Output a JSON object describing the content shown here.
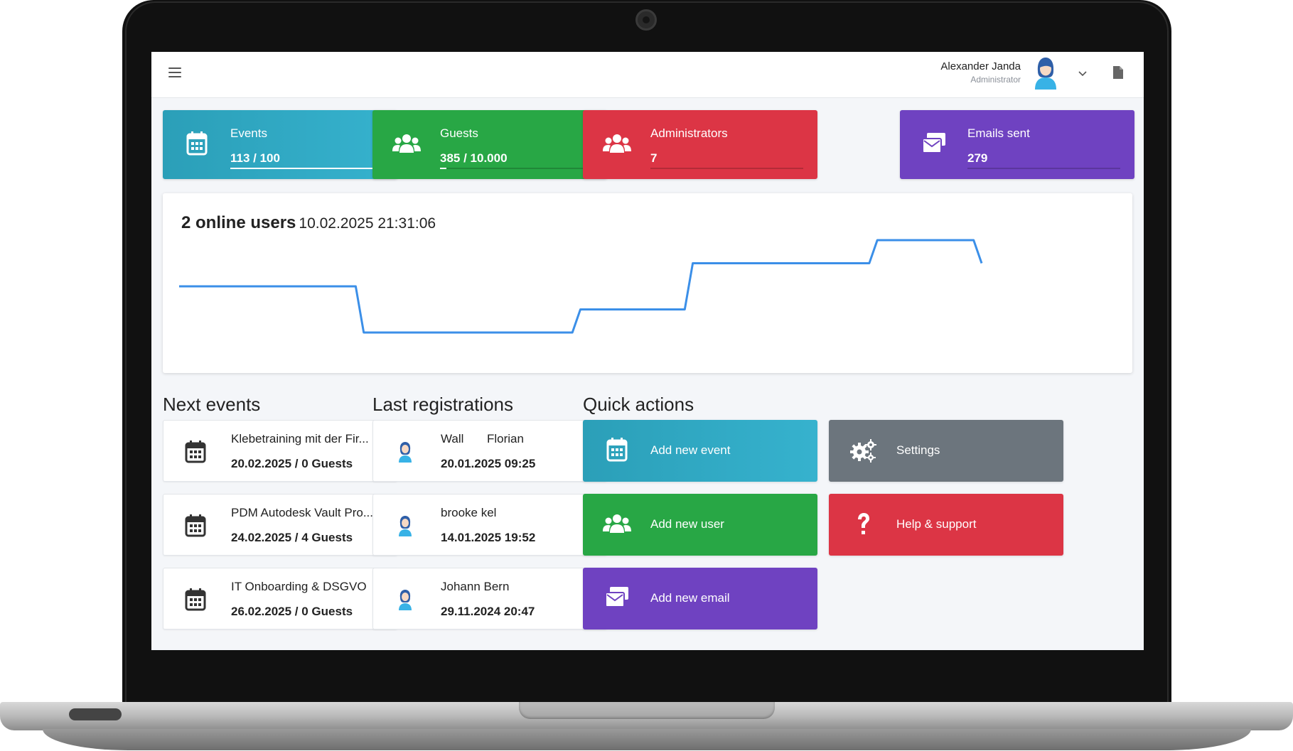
{
  "header": {
    "user_name": "Alexander Janda",
    "user_role": "Administrator"
  },
  "stats": [
    {
      "label": "Events",
      "value": "113 / 100",
      "progress": 1.0,
      "color": "#2fa9c2",
      "icon": "calendar-icon"
    },
    {
      "label": "Guests",
      "value": "385 / 10.000",
      "progress": 0.04,
      "color": "#28a745",
      "icon": "users-icon"
    },
    {
      "label": "Administrators",
      "value": "7",
      "progress": 0,
      "color": "#dc3545",
      "icon": "users-icon"
    },
    {
      "label": "Emails sent",
      "value": "279",
      "progress": 0,
      "color": "#6f42c1",
      "icon": "mail-stack-icon"
    }
  ],
  "online": {
    "title": "2 online users",
    "timestamp": "10.02.2025 21:31:06"
  },
  "chart_data": {
    "type": "line",
    "x": [
      0,
      0.22,
      0.23,
      0.49,
      0.5,
      0.63,
      0.64,
      0.86,
      0.87,
      0.99,
      1.0
    ],
    "y": [
      3,
      3,
      1,
      1,
      2,
      2,
      4,
      4,
      5,
      5,
      4
    ],
    "color": "#3b8fe8",
    "grid": false
  },
  "next_events": {
    "title": "Next events",
    "items": [
      {
        "name": "Klebetraining mit der Fir...",
        "info": "20.02.2025 / 0 Guests"
      },
      {
        "name": "PDM Autodesk Vault Pro...",
        "info": "24.02.2025 / 4 Guests"
      },
      {
        "name": "IT Onboarding & DSGVO",
        "info": "26.02.2025 / 0 Guests"
      }
    ]
  },
  "registrations": {
    "title": "Last registrations",
    "items": [
      {
        "first": "Wall",
        "last": "Florian",
        "date": "20.01.2025 09:25"
      },
      {
        "first": "brooke kel",
        "last": "",
        "date": "14.01.2025 19:52"
      },
      {
        "first": "Johann Bern",
        "last": "",
        "date": "29.11.2024 20:47"
      }
    ]
  },
  "quick_actions": {
    "title": "Quick actions",
    "items": [
      {
        "label": "Add new event",
        "color": "#2fa9c2",
        "icon": "calendar-icon"
      },
      {
        "label": "Settings",
        "color": "#6c757d",
        "icon": "gears-icon"
      },
      {
        "label": "Add new user",
        "color": "#28a745",
        "icon": "users-icon"
      },
      {
        "label": "Help & support",
        "color": "#dc3545",
        "icon": "question-icon"
      },
      {
        "label": "Add new email",
        "color": "#6f42c1",
        "icon": "mail-stack-icon"
      }
    ]
  }
}
